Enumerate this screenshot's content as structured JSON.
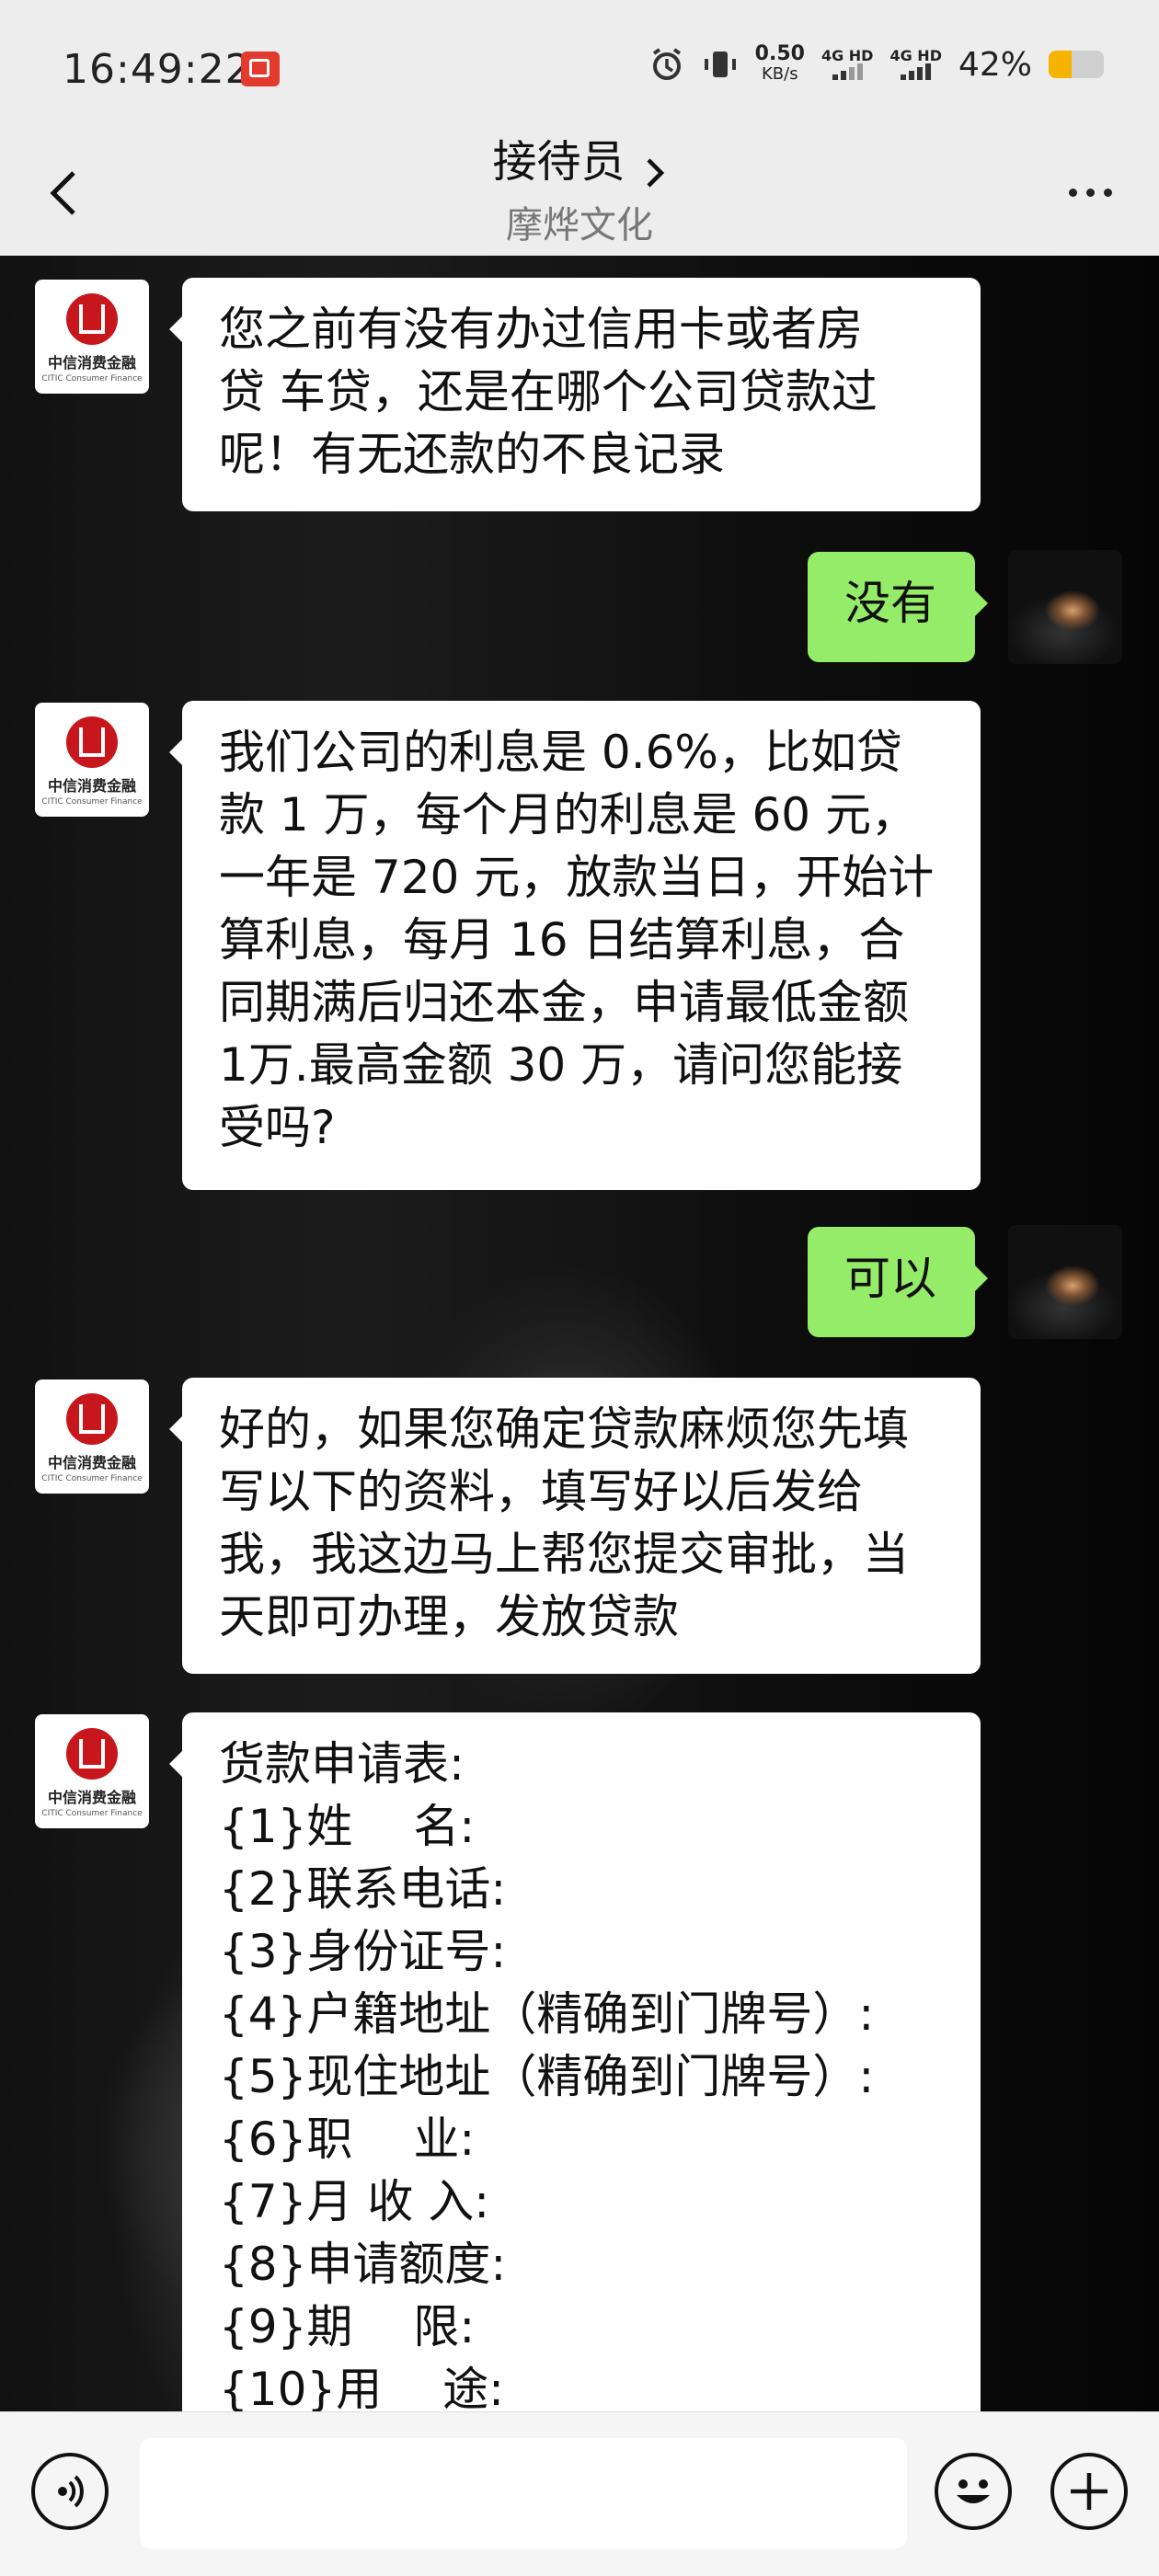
{
  "status_bar": {
    "time": "16:49:22",
    "net_speed_value": "0.50",
    "net_speed_unit": "KB/s",
    "sim1_label": "4G HD",
    "sim2_label": "4G HD",
    "battery_text": "42%",
    "battery_level": 0.42,
    "battery_color": "#f5b400"
  },
  "header": {
    "title": "接待员",
    "subtitle": "摩烨文化"
  },
  "contact_avatar": {
    "name_cn": "中信消费金融",
    "name_en": "CITIC Consumer Finance",
    "logo_color": "#c8161d"
  },
  "messages": [
    {
      "side": "left",
      "lines": [
        "您之前有没有办过信用卡或者房",
        "贷 车贷，还是在哪个公司贷款过",
        "呢！有无还款的不良记录"
      ]
    },
    {
      "side": "right",
      "lines": [
        "没有"
      ]
    },
    {
      "side": "left",
      "lines": [
        "我们公司的利息是 0.6%，比如贷",
        "款 1 万，每个月的利息是 60 元，",
        "一年是 720 元，放款当日，开始计",
        "算利息，每月 16 日结算利息，合",
        "同期满后归还本金，申请最低金额",
        "1万.最高金额 30 万，请问您能接",
        "受吗?"
      ]
    },
    {
      "side": "right",
      "lines": [
        "可以"
      ]
    },
    {
      "side": "left",
      "lines": [
        "好的，如果您确定贷款麻烦您先填",
        "写以下的资料，填写好以后发给",
        "我，我这边马上帮您提交审批，当",
        "天即可办理，发放贷款"
      ]
    },
    {
      "side": "left",
      "form_title": "货款申请表:",
      "form_items": [
        "{1}姓　 名:",
        "{2}联系电话:",
        "{3}身份证号:",
        "{4}户籍地址（精确到门牌号）:",
        "{5}现住地址（精确到门牌号）:",
        "{6}职　 业:",
        "{7}月 收 入:",
        "{8}申请额度:",
        "{9}期　 限:",
        "{10}用　 途:"
      ]
    }
  ],
  "input_bar": {
    "left_icon": "voice-icon",
    "right_icons": [
      "emoji-icon",
      "plus-icon"
    ]
  },
  "colors": {
    "bubble_self": "#95ec69",
    "bubble_other": "#ffffff",
    "bar_background": "#ededed"
  }
}
